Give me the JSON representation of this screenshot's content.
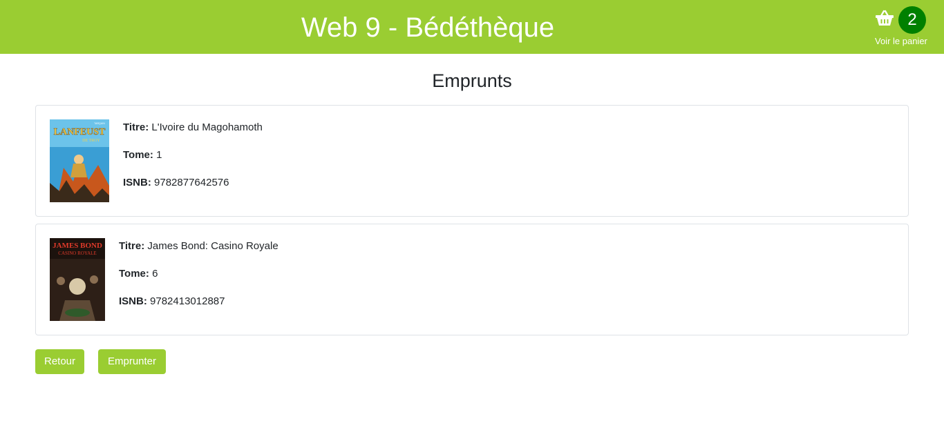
{
  "header": {
    "title": "Web 9 - Bédéthèque",
    "cart_icon": "basket-icon",
    "cart_count": "2",
    "cart_label": "Voir le panier",
    "background_color": "#9acd32",
    "badge_color": "#008000"
  },
  "page_title": "Emprunts",
  "books": [
    {
      "cover_text": "LANFEUST",
      "cover_subtext": "DE TROY",
      "cover_author": "TARQUIN",
      "title_label": "Titre:",
      "title_value": "L'Ivoire du Magohamoth",
      "tome_label": "Tome:",
      "tome_value": "1",
      "isbn_label": "ISNB:",
      "isbn_value": "9782877642576"
    },
    {
      "cover_text": "JAMES BOND",
      "cover_subtext": "CASINO ROYALE",
      "title_label": "Titre:",
      "title_value": "James Bond: Casino Royale",
      "tome_label": "Tome:",
      "tome_value": "6",
      "isbn_label": "ISNB:",
      "isbn_value": "9782413012887"
    }
  ],
  "actions": {
    "back_label": "Retour",
    "borrow_label": "Emprunter"
  }
}
